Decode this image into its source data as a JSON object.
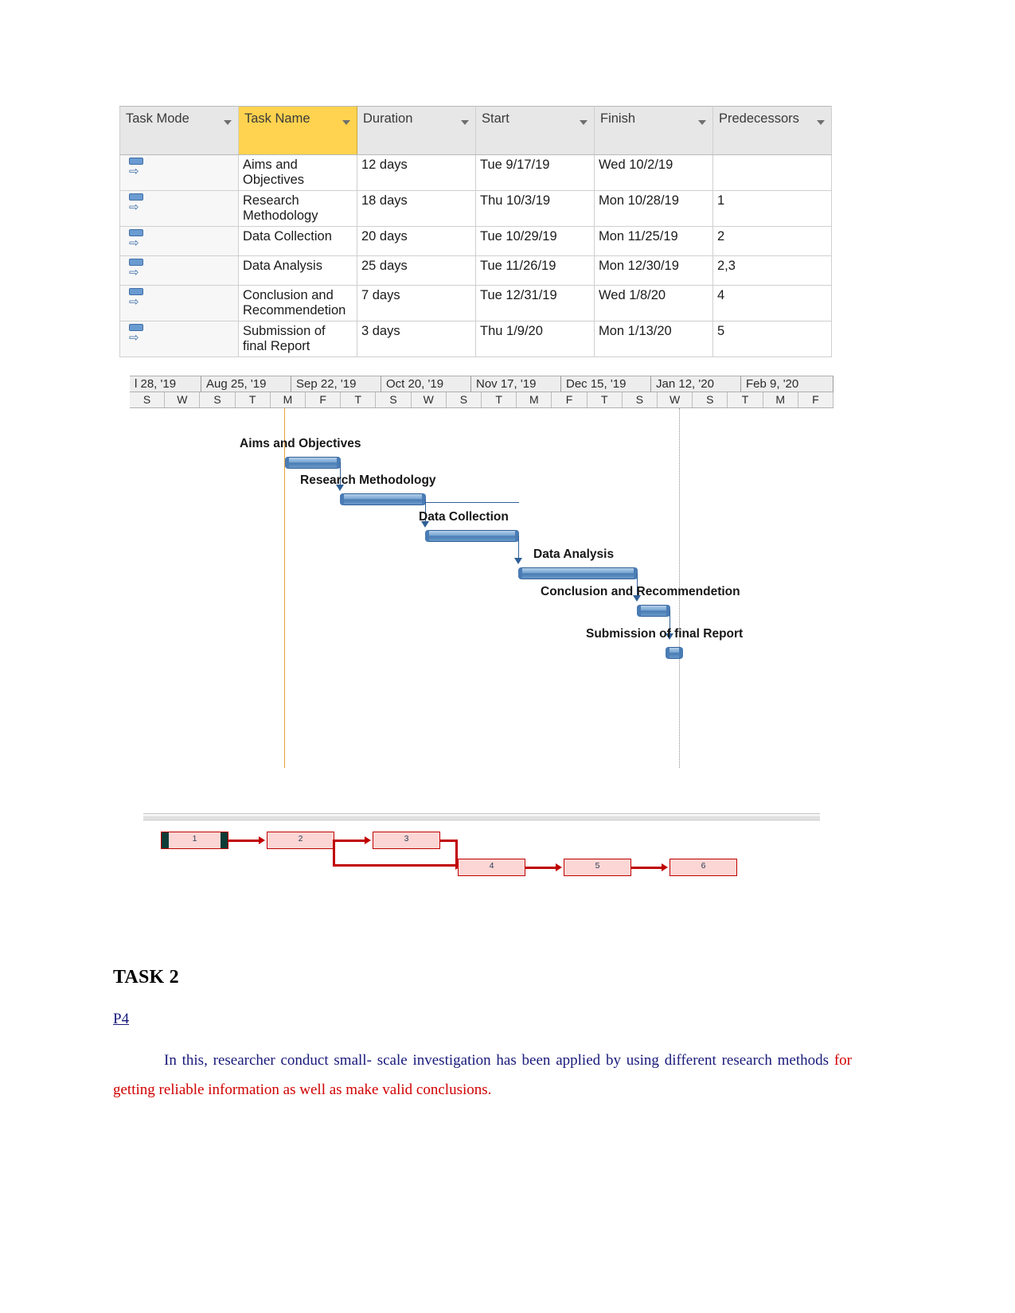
{
  "gantt_table": {
    "columns": [
      {
        "key": "task_mode",
        "label": "Task Mode",
        "caret": "chevron-down-icon"
      },
      {
        "key": "task_name",
        "label": "Task Name",
        "caret": "chevron-down-icon"
      },
      {
        "key": "duration",
        "label": "Duration",
        "caret": "chevron-down-icon"
      },
      {
        "key": "start",
        "label": "Start",
        "caret": "chevron-down-icon"
      },
      {
        "key": "finish",
        "label": "Finish",
        "caret": "chevron-down-icon"
      },
      {
        "key": "predecessors",
        "label": "Predecessors",
        "caret": "chevron-down-icon"
      }
    ],
    "highlight_color": "#ffd34f",
    "rows": [
      {
        "id": 1,
        "mode_icon": "auto-schedule-icon",
        "task_name": "Aims and Objectives",
        "duration": "12 days",
        "start": "Tue 9/17/19",
        "finish": "Wed 10/2/19",
        "predecessors": ""
      },
      {
        "id": 2,
        "mode_icon": "auto-schedule-icon",
        "task_name": "Research Methodology",
        "duration": "18 days",
        "start": "Thu 10/3/19",
        "finish": "Mon 10/28/19",
        "predecessors": "1"
      },
      {
        "id": 3,
        "mode_icon": "auto-schedule-icon",
        "task_name": "Data Collection",
        "duration": "20 days",
        "start": "Tue 10/29/19",
        "finish": "Mon 11/25/19",
        "predecessors": "2"
      },
      {
        "id": 4,
        "mode_icon": "auto-schedule-icon",
        "task_name": "Data Analysis",
        "duration": "25 days",
        "start": "Tue 11/26/19",
        "finish": "Mon 12/30/19",
        "predecessors": "2,3"
      },
      {
        "id": 5,
        "mode_icon": "auto-schedule-icon",
        "task_name": "Conclusion and Recommendetion",
        "duration": "7 days",
        "start": "Tue 12/31/19",
        "finish": "Wed 1/8/20",
        "predecessors": "4"
      },
      {
        "id": 6,
        "mode_icon": "auto-schedule-icon",
        "task_name": "Submission of final Report",
        "duration": "3 days",
        "start": "Thu 1/9/20",
        "finish": "Mon 1/13/20",
        "predecessors": "5"
      }
    ]
  },
  "chart_data": {
    "type": "bar",
    "title": "Gantt Chart Timeline",
    "xlabel": "",
    "ylabel": "",
    "grid": false,
    "legend": "none",
    "timeline_months": [
      "l 28, '19",
      "Aug 25, '19",
      "Sep 22, '19",
      "Oct 20, '19",
      "Nov 17, '19",
      "Dec 15, '19",
      "Jan 12, '20",
      "Feb 9, '20"
    ],
    "timeline_days": [
      "S",
      "W",
      "S",
      "T",
      "M",
      "F",
      "T",
      "S",
      "W",
      "S",
      "T",
      "M",
      "F",
      "T",
      "S",
      "W",
      "S",
      "T",
      "M",
      "F"
    ],
    "bars": [
      {
        "label": "Aims and Objectives",
        "duration": "12 days",
        "start": "Tue 9/17/19",
        "finish": "Wed 10/2/19",
        "color": "#4a7cb4"
      },
      {
        "label": "Research Methodology",
        "duration": "18 days",
        "start": "Thu 10/3/19",
        "finish": "Mon 10/28/19",
        "color": "#4a7cb4"
      },
      {
        "label": "Data Collection",
        "duration": "20 days",
        "start": "Tue 10/29/19",
        "finish": "Mon 11/25/19",
        "color": "#4a7cb4"
      },
      {
        "label": "Data Analysis",
        "duration": "25 days",
        "start": "Tue 11/26/19",
        "finish": "Mon 12/30/19",
        "color": "#4a7cb4"
      },
      {
        "label": "Conclusion and Recommendetion",
        "duration": "7 days",
        "start": "Tue 12/31/19",
        "finish": "Wed 1/8/20",
        "color": "#4a7cb4"
      },
      {
        "label": "Submission of final Report",
        "duration": "3 days",
        "start": "Thu 1/9/20",
        "finish": "Mon 1/13/20",
        "color": "#4a7cb4"
      }
    ]
  },
  "network_diagram": {
    "node_fill": "#fbd6d4",
    "node_border": "#c00000",
    "nodes": [
      {
        "id": "1",
        "label": "1",
        "critical": true
      },
      {
        "id": "2",
        "label": "2",
        "critical": false
      },
      {
        "id": "3",
        "label": "3",
        "critical": false
      },
      {
        "id": "4",
        "label": "4",
        "critical": false
      },
      {
        "id": "5",
        "label": "5",
        "critical": false
      },
      {
        "id": "6",
        "label": "6",
        "critical": false
      }
    ],
    "links": [
      {
        "from": "1",
        "to": "2"
      },
      {
        "from": "2",
        "to": "3"
      },
      {
        "from": "2",
        "to": "4"
      },
      {
        "from": "3",
        "to": "4"
      },
      {
        "from": "4",
        "to": "5"
      },
      {
        "from": "5",
        "to": "6"
      }
    ]
  },
  "task2": {
    "title": "TASK 2",
    "subheading": "P4",
    "paragraph_part1": "In this, researcher conduct small- scale investigation has been applied by using different research methods ",
    "paragraph_part2": "for getting reliable information as well as make valid conclusions.",
    "text_color": "#18197a",
    "highlight_color": "#d10000"
  }
}
